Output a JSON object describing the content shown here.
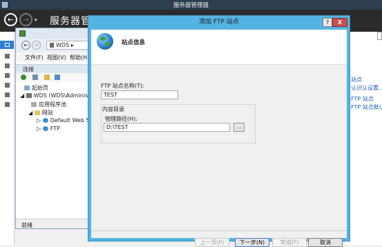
{
  "server_manager": {
    "window_title": "服务器管理器",
    "header_title": "服务器管理",
    "right_links": [
      "站点",
      "认识认设置...",
      "FTP 站点",
      "FTP 站点默认值..."
    ]
  },
  "iis": {
    "address": [
      "WDS",
      "▸"
    ],
    "menu": [
      "文件(F)",
      "视图(V)",
      "帮助(H)"
    ],
    "connections_label": "连接",
    "tree": {
      "start_page": "起始页",
      "server": "WDS (WDS\\Administrat",
      "app_pools": "应用程序池",
      "sites": "网站",
      "default_site": "Default Web Site",
      "ftp": "FTP"
    },
    "status": "就绪"
  },
  "dialog": {
    "title": "添加 FTP 站点",
    "help": "?",
    "close": "X",
    "banner_title": "站点信息",
    "site_name_label": "FTP 站点名称(T):",
    "site_name_value": "TEST",
    "content_dir_label": "内容目录",
    "physical_path_label": "物理路径(H):",
    "physical_path_value": "D:\\TEST",
    "browse": "...",
    "buttons": {
      "previous": "上一页(P)",
      "next": "下一步(N)",
      "finish": "完成(F)",
      "cancel": "取消"
    }
  }
}
